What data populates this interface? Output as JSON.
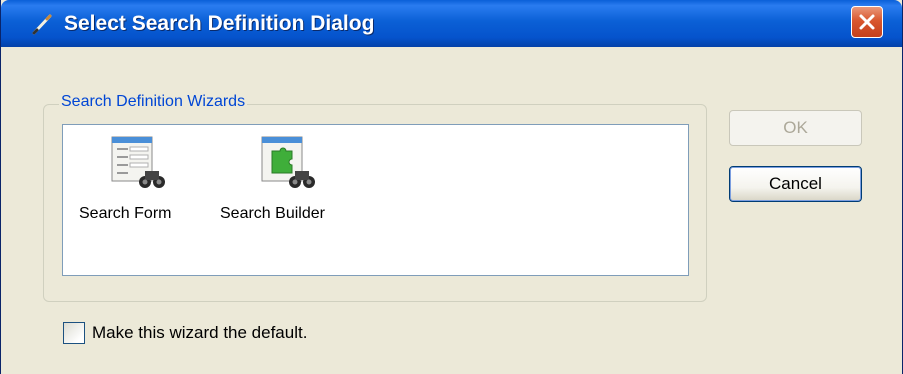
{
  "window": {
    "title": "Select Search Definition Dialog",
    "close_icon": "close-icon",
    "title_icon": "pencil-icon",
    "accent_color": "#0553cc"
  },
  "group": {
    "legend": "Search Definition Wizards",
    "items": [
      {
        "label": "Search Form",
        "icon": "search-form-icon"
      },
      {
        "label": "Search Builder",
        "icon": "search-builder-icon"
      }
    ]
  },
  "buttons": {
    "ok_label": "OK",
    "ok_enabled": false,
    "cancel_label": "Cancel"
  },
  "default_checkbox": {
    "label": "Make this wizard the default.",
    "checked": false
  }
}
